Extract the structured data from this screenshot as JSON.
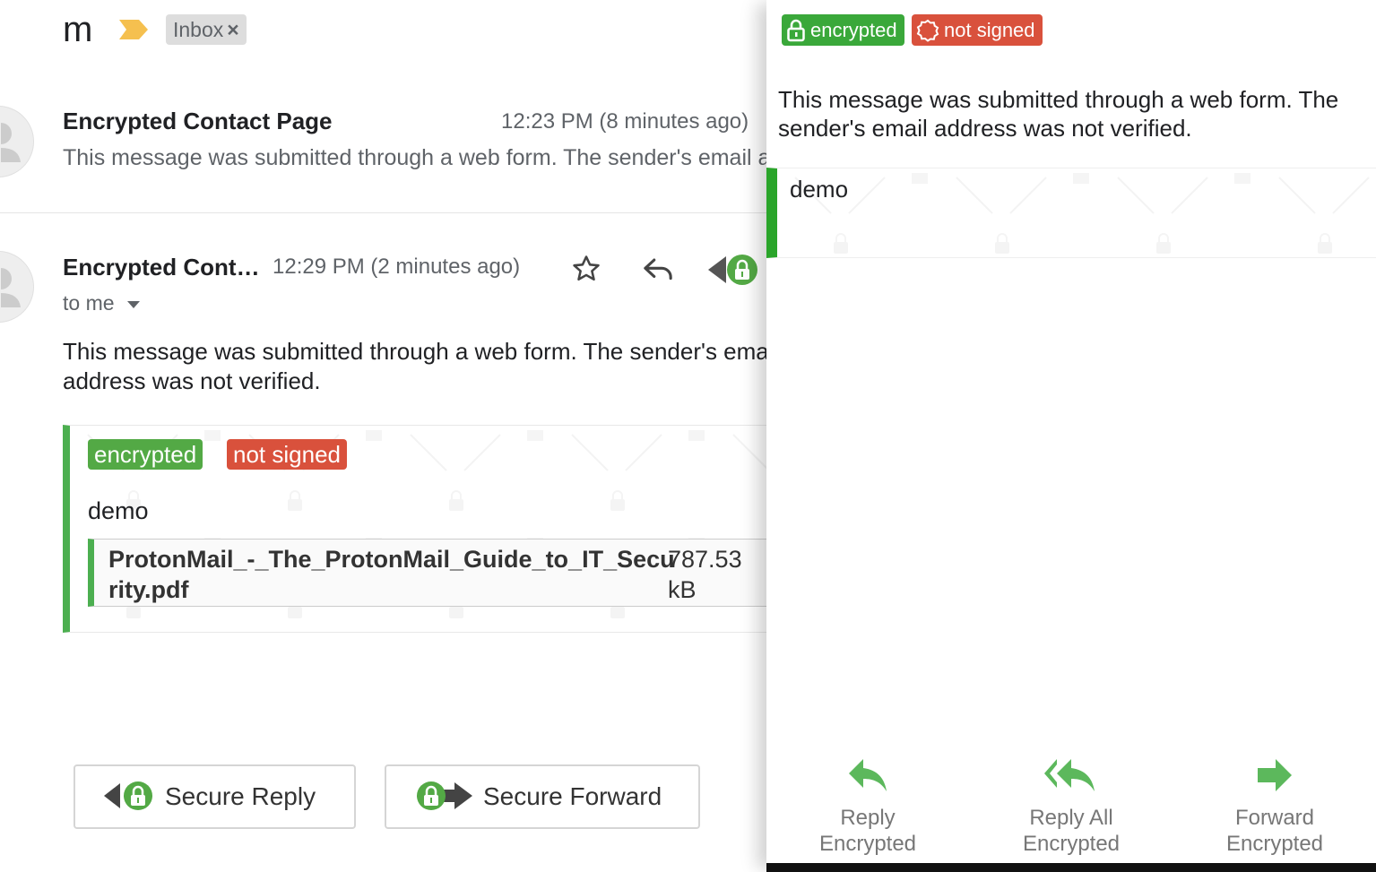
{
  "header": {
    "subject_fragment": "m",
    "label_chip": "Inbox",
    "chip_remove": "×"
  },
  "thread": {
    "message1": {
      "sender": "Encrypted Contact Page",
      "time": "12:23 PM (8 minutes ago)",
      "snippet": "This message was submitted through a web form. The sender's email address was not verified."
    },
    "message2": {
      "sender": "Encrypted Cont…",
      "time": "12:29 PM (2 minutes ago)",
      "recipient": "to me",
      "body": "This message was submitted through a web form. The sender's email address was not verified.",
      "badge_encrypted": "encrypted",
      "badge_not_signed": "not signed",
      "content": "demo",
      "attachment": {
        "name": "ProtonMail_-_The_ProtonMail_Guide_to_IT_Security.pdf",
        "size": "787.53 kB"
      }
    },
    "buttons": {
      "secure_reply": "Secure Reply",
      "secure_forward": "Secure Forward"
    }
  },
  "panel": {
    "badge_encrypted": "encrypted",
    "badge_not_signed": "not signed",
    "notice": "This message was submitted through a web form. The sender's email address was not verified.",
    "content": "demo",
    "actions": {
      "reply_line1": "Reply",
      "reply_line2": "Encrypted",
      "reply_all_line1": "Reply All",
      "reply_all_line2": "Encrypted",
      "forward_line1": "Forward",
      "forward_line2": "Encrypted"
    }
  },
  "colors": {
    "accent_green": "#4caf50",
    "badge_green": "#53a945",
    "badge_red": "#d9513c",
    "importance_yellow": "#f5c04f"
  }
}
